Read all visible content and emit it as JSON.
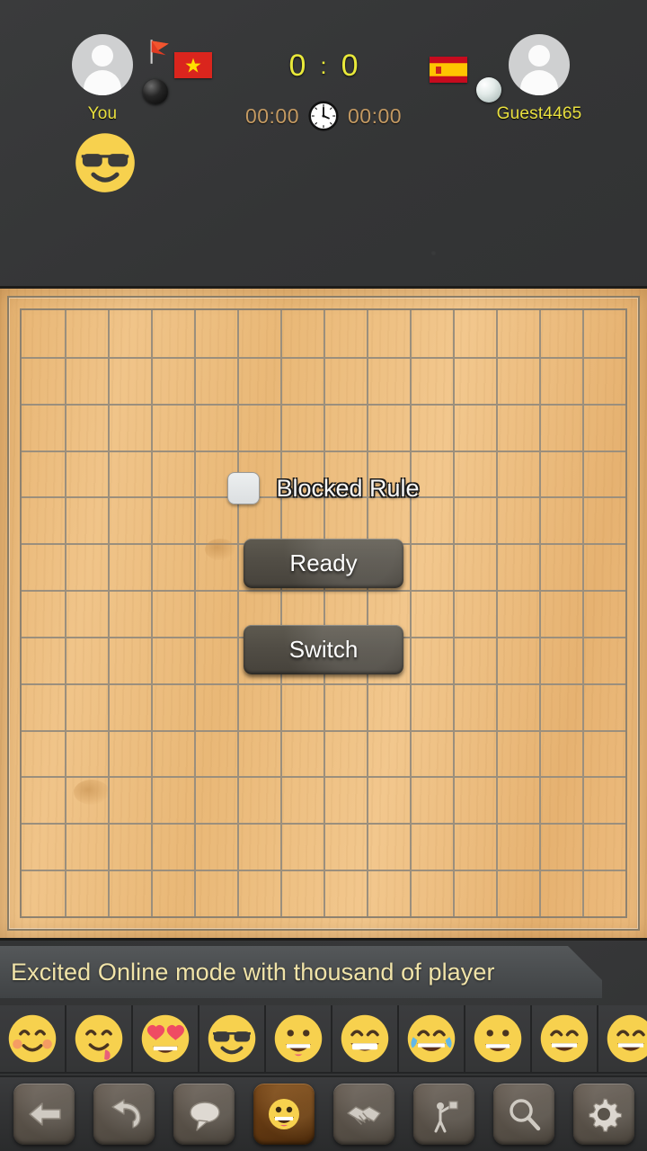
{
  "header": {
    "left_player": {
      "name": "You",
      "stone": "black-stone",
      "country_flag": "vietnam-flag",
      "host_marker": "red-flag-icon",
      "avatar": "default-avatar"
    },
    "right_player": {
      "name": "Guest4465",
      "stone": "white-stone",
      "country_flag": "spain-flag",
      "avatar": "default-avatar"
    },
    "score": {
      "left": "0",
      "separator": ":",
      "right": "0"
    },
    "timers": {
      "left": "00:00",
      "right": "00:00",
      "icon": "clock-icon"
    },
    "chat_message_emoji": "sunglasses-emoji"
  },
  "board": {
    "columns": 14,
    "rows": 13,
    "material": "wood",
    "grid_color": "#9b8f7d"
  },
  "overlay": {
    "rule_checkbox_label": "Blocked Rule",
    "rule_checked": false,
    "ready_label": "Ready",
    "switch_label": "Switch"
  },
  "banner": {
    "text": "Excited Online mode with thousand of player"
  },
  "emoji_strip": [
    {
      "name": "blush-emoji"
    },
    {
      "name": "yum-emoji"
    },
    {
      "name": "heart-eyes-emoji"
    },
    {
      "name": "sunglasses-emoji"
    },
    {
      "name": "grinning-emoji"
    },
    {
      "name": "grin-emoji"
    },
    {
      "name": "joy-emoji"
    },
    {
      "name": "grinning-open-emoji"
    },
    {
      "name": "smile-emoji"
    },
    {
      "name": "laughing-emoji"
    }
  ],
  "toolbar": [
    {
      "name": "back-button",
      "icon": "back-arrow-icon",
      "active": false
    },
    {
      "name": "undo-button",
      "icon": "undo-arrow-icon",
      "active": false
    },
    {
      "name": "chat-button",
      "icon": "speech-bubble-icon",
      "active": false
    },
    {
      "name": "emoji-button",
      "icon": "smiley-icon",
      "active": true
    },
    {
      "name": "handshake-button",
      "icon": "handshake-icon",
      "active": false
    },
    {
      "name": "surrender-button",
      "icon": "surrender-flag-person-icon",
      "active": false
    },
    {
      "name": "zoom-button",
      "icon": "magnifier-icon",
      "active": false
    },
    {
      "name": "settings-button",
      "icon": "gear-icon",
      "active": false
    }
  ],
  "colors": {
    "score_yellow": "#e9e93a",
    "name_yellow": "#e9e03f",
    "timer_tan": "#c49a62",
    "banner_cream": "#f0e3a8",
    "board_wood": "#eab877",
    "background_slate": "#343536"
  }
}
